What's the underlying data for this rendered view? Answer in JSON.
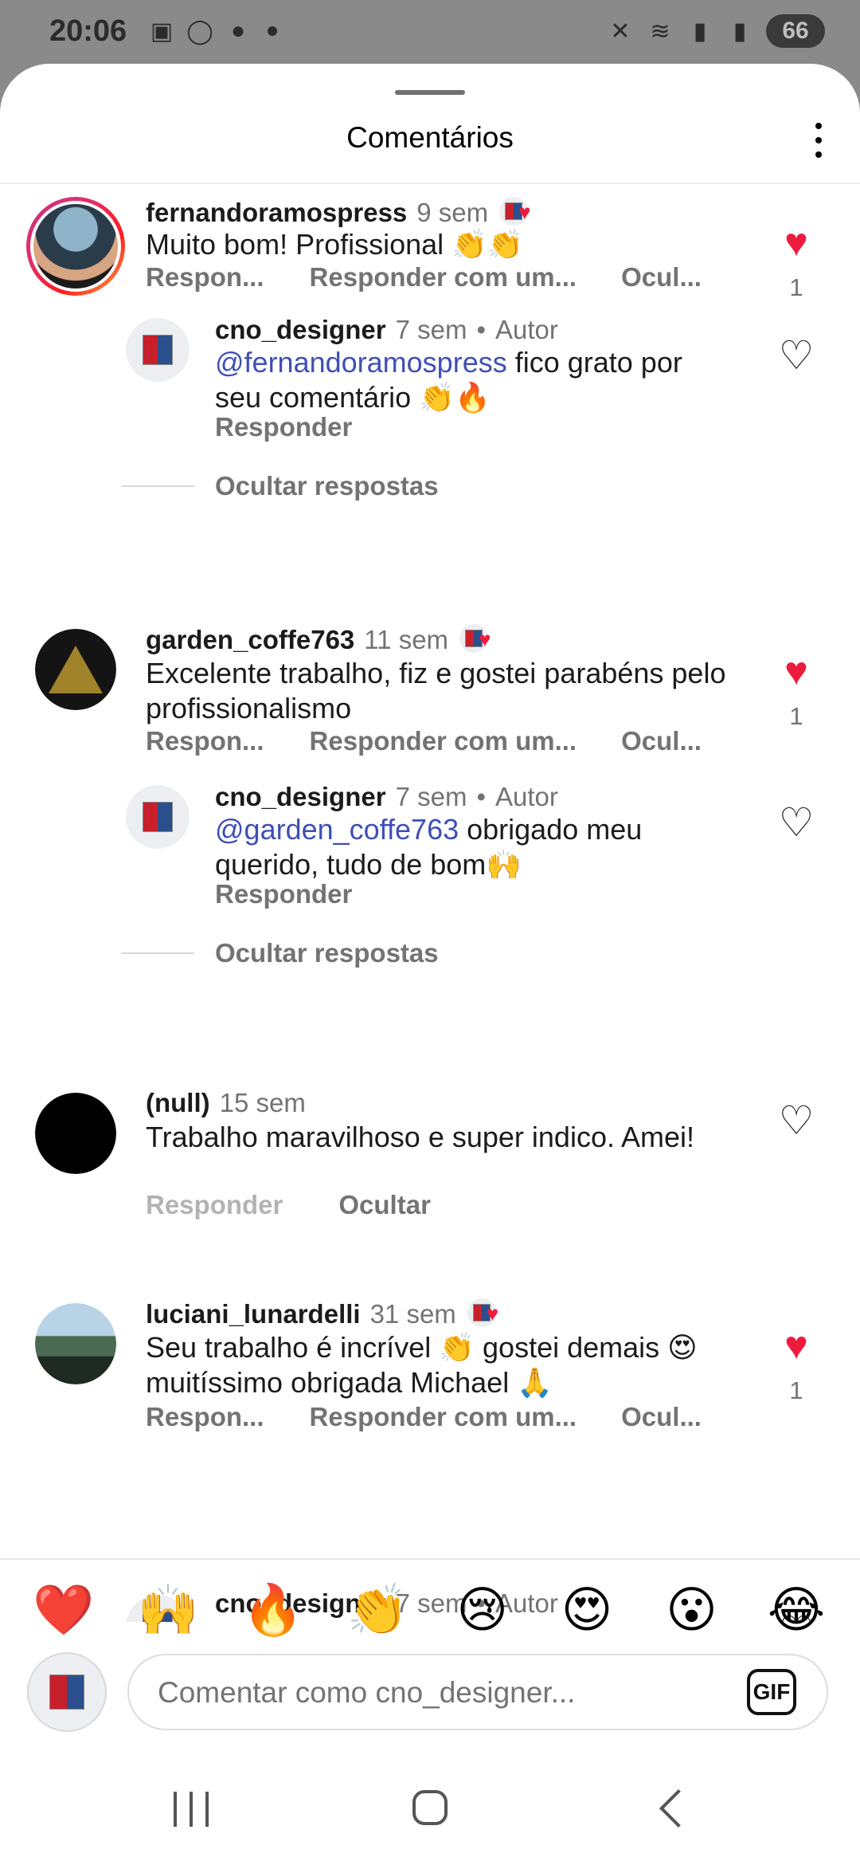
{
  "status_bar": {
    "time": "20:06",
    "left_icons": [
      "screenshot-icon",
      "whatsapp-icon",
      "chat-icon",
      "dot-icon"
    ],
    "right_icons": [
      "mute-icon",
      "wifi-icon",
      "signal-icon",
      "signal-icon"
    ],
    "battery": "66"
  },
  "header": {
    "title": "Comentários"
  },
  "comments": [
    {
      "username": "fernandoramospress",
      "time": "9 sem",
      "text": "Muito bom! Profissional 👏👏",
      "actions": [
        "Respon...",
        "Responder com um...",
        "Ocul..."
      ],
      "like_count": "1",
      "liked": true
    },
    {
      "username": "cno_designer",
      "time": "7 sem",
      "author_label": "Autor",
      "mention": "@fernandoramospress",
      "text": " fico grato por seu comentário 👏🔥",
      "reply_label": "Responder",
      "hide_replies": "Ocultar respostas"
    },
    {
      "username": "garden_coffe763",
      "time": "11 sem",
      "text": "Excelente trabalho, fiz e gostei parabéns pelo profissionalismo",
      "actions": [
        "Respon...",
        "Responder com um...",
        "Ocul..."
      ],
      "like_count": "1",
      "liked": true
    },
    {
      "username": "cno_designer",
      "time": "7 sem",
      "author_label": "Autor",
      "mention": "@garden_coffe763",
      "text": " obrigado meu querido, tudo de bom🙌",
      "reply_label": "Responder",
      "hide_replies": "Ocultar respostas"
    },
    {
      "username": "(null)",
      "time": "15 sem",
      "text": "Trabalho maravilhoso e super indico. Amei!",
      "reply_label": "Responder",
      "hide_label": "Ocultar"
    },
    {
      "username": "luciani_lunardelli",
      "time": "31 sem",
      "text": "Seu trabalho é incrível 👏 gostei demais 😍 muitíssimo obrigada Michael 🙏",
      "actions": [
        "Respon...",
        "Responder com um...",
        "Ocul..."
      ],
      "like_count": "1",
      "liked": true
    },
    {
      "username": "cno_designer",
      "time": "7 sem",
      "author_label": "Autor"
    }
  ],
  "emoji_bar": [
    "❤️",
    "🙌",
    "🔥",
    "👏",
    "😢",
    "😍",
    "😮",
    "😂"
  ],
  "composer": {
    "placeholder": "Comentar como cno_designer...",
    "gif_label": "GIF"
  },
  "colors": {
    "heart_red": "#ed1c3e",
    "mention_blue": "#3f4fb6",
    "muted_gray": "#737373"
  }
}
